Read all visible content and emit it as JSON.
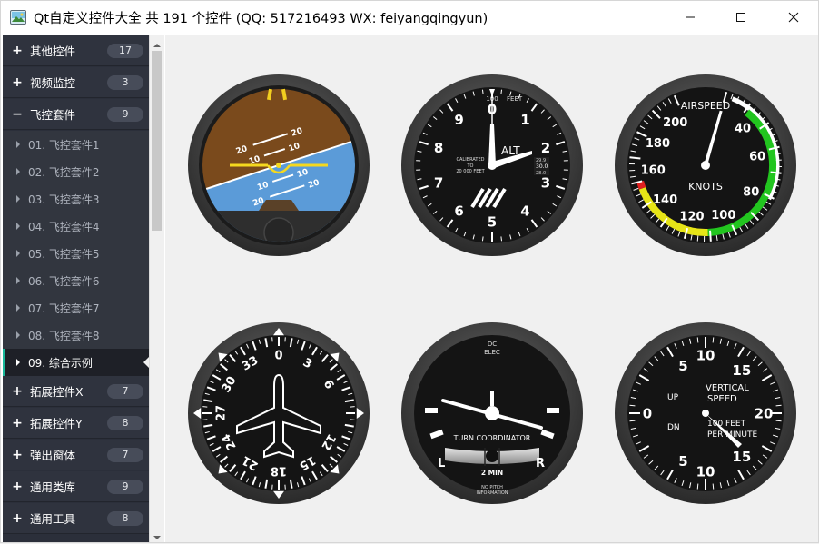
{
  "window": {
    "title": "Qt自定义控件大全 共 191 个控件 (QQ: 517216493 WX: feiyangqingyun)",
    "icons": {
      "app": "image-icon",
      "minimize": "minimize-icon",
      "maximize": "maximize-icon",
      "close": "close-icon"
    }
  },
  "sidebar": {
    "groups_top": [
      {
        "sign": "+",
        "label": "其他控件",
        "count": "17"
      },
      {
        "sign": "+",
        "label": "视频监控",
        "count": "3"
      },
      {
        "sign": "−",
        "label": "飞控套件",
        "count": "9"
      }
    ],
    "sub_items": [
      {
        "label": "01. 飞控套件1"
      },
      {
        "label": "02. 飞控套件2"
      },
      {
        "label": "03. 飞控套件3"
      },
      {
        "label": "04. 飞控套件4"
      },
      {
        "label": "05. 飞控套件5"
      },
      {
        "label": "06. 飞控套件6"
      },
      {
        "label": "07. 飞控套件7"
      },
      {
        "label": "08. 飞控套件8"
      },
      {
        "label": "09. 综合示例"
      }
    ],
    "active_index": 8,
    "groups_bottom": [
      {
        "sign": "+",
        "label": "拓展控件X",
        "count": "7"
      },
      {
        "sign": "+",
        "label": "拓展控件Y",
        "count": "8"
      },
      {
        "sign": "+",
        "label": "弹出窗体",
        "count": "7"
      },
      {
        "sign": "+",
        "label": "通用类库",
        "count": "9"
      },
      {
        "sign": "+",
        "label": "通用工具",
        "count": "8"
      }
    ],
    "accent_color": "#18b89a"
  },
  "gauges": {
    "attitude": {
      "pitch_labels": [
        "20",
        "10",
        "10",
        "20",
        "10",
        "20"
      ],
      "colors": {
        "sky": "#5b9bd8",
        "ground": "#7a4a1c"
      }
    },
    "altimeter": {
      "numbers": [
        "0",
        "1",
        "2",
        "3",
        "4",
        "5",
        "6",
        "7",
        "8",
        "9"
      ],
      "top_small": "100",
      "unit": "FEET",
      "alt": "ALT",
      "calibrated_1": "CALIBRATED",
      "calibrated_2": "TO",
      "calibrated_3": "20 000 FEET",
      "kollsman_1": "29.9",
      "kollsman_2": "30.0",
      "kollsman_3": "28.0"
    },
    "airspeed": {
      "title": "AIRSPEED",
      "unit": "KNOTS",
      "numbers": [
        "40",
        "60",
        "80",
        "100",
        "120",
        "140",
        "160",
        "180",
        "200"
      ]
    },
    "heading": {
      "numbers": [
        "0",
        "3",
        "6",
        "12",
        "15",
        "18",
        "21",
        "24",
        "27",
        "30",
        "33"
      ]
    },
    "turn": {
      "top_1": "DC",
      "top_2": "ELEC",
      "title": "TURN COORDINATOR",
      "left": "L",
      "right": "R",
      "min": "2 MIN",
      "note_1": "NO PITCH",
      "note_2": "INFORMATION"
    },
    "vsi": {
      "numbers": [
        "5",
        "10",
        "15",
        "20",
        "15",
        "10",
        "5",
        "0"
      ],
      "up": "UP",
      "dn": "DN",
      "title_1": "VERTICAL",
      "title_2": "SPEED",
      "unit_1": "100 FEET",
      "unit_2": "PER MINUTE"
    }
  }
}
